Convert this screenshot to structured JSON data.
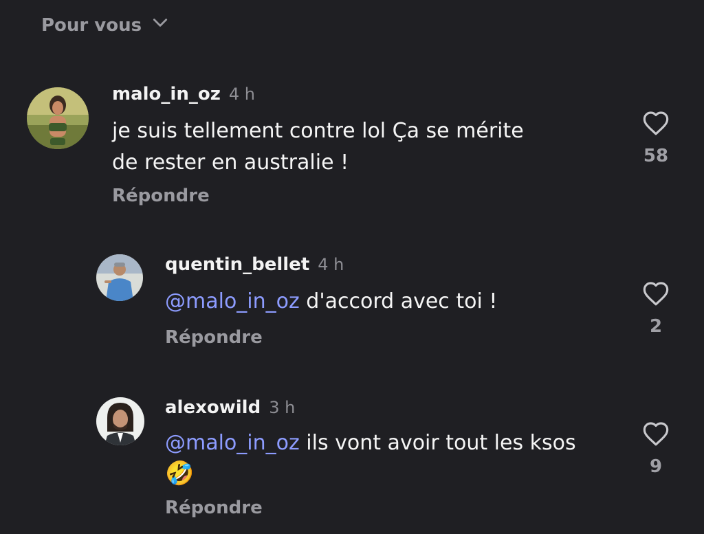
{
  "header": {
    "sort_label": "Pour vous",
    "sort_icon": "chevron-down-icon"
  },
  "comments": [
    {
      "username": "malo_in_oz",
      "time": "4 h",
      "mention": "",
      "text": "je suis tellement contre lol Ça se mérite de rester en australie !",
      "likes": "58",
      "reply_label": "Répondre"
    },
    {
      "username": "quentin_bellet",
      "time": "4 h",
      "mention": "@malo_in_oz",
      "text": "d'accord avec toi !",
      "likes": "2",
      "reply_label": "Répondre"
    },
    {
      "username": "alexowild",
      "time": "3 h",
      "mention": "@malo_in_oz",
      "text": "ils vont avoir tout les ksos",
      "emoji": "🤣",
      "likes": "9",
      "reply_label": "Répondre"
    }
  ],
  "colors": {
    "background": "#1f1f23",
    "mention": "#8d9cff",
    "muted": "#9a9aa0"
  }
}
